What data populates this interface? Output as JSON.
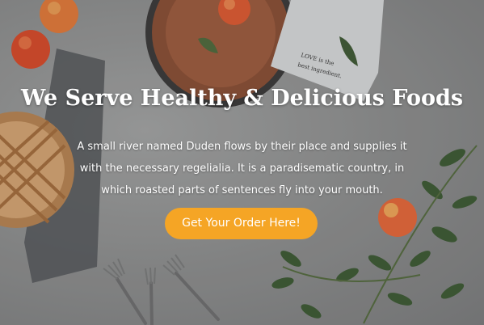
{
  "hero": {
    "title": "We Serve Healthy & Delicious Foods",
    "description_lines": [
      "A small river named Duden flows by their place and supplies it",
      "with the necessary regelialia. It is a paradisematic country, in",
      "which roasted parts of sentences fly into your mouth."
    ],
    "cta_label": "Get Your Order Here!",
    "napkin_text": "LOVE is the best ingredient."
  },
  "colors": {
    "accent": "#f5a525",
    "text": "#ffffff",
    "background": "#8f9090"
  },
  "icons": [
    "apple-icon",
    "pie-icon",
    "plate-icon",
    "fork-icon",
    "leaf-icon"
  ]
}
